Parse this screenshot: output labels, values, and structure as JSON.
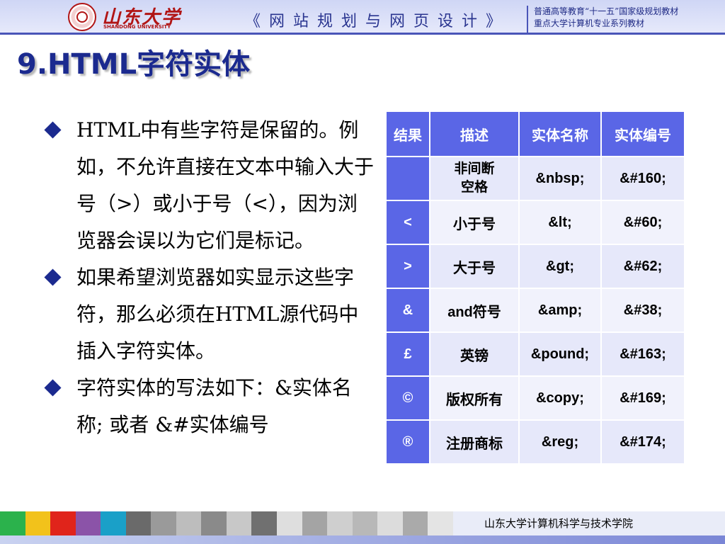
{
  "header": {
    "logo_cn": "山东大学",
    "logo_en": "SHANDONG UNIVERSITY",
    "course_title": "《网站规划与网页设计》",
    "series_line1": "普通高等教育“十一五”国家级规划教材",
    "series_line2": "重点大学计算机专业系列教材"
  },
  "slide": {
    "title": "9.HTML字符实体"
  },
  "bullets": [
    "HTML中有些字符是保留的。例如，不允许直接在文本中输入大于号（>）或小于号（<），因为浏览器会误以为它们是标记。",
    "如果希望浏览器如实显示这些字符，那么必须在HTML源代码中插入字符实体。",
    "字符实体的写法如下：&实体名称; 或者 &#实体编号"
  ],
  "table": {
    "headers": [
      "结果",
      "描述",
      "实体名称",
      "实体编号"
    ],
    "rows": [
      [
        "",
        "非间断空格",
        "&nbsp;",
        "&#160;"
      ],
      [
        "<",
        "小于号",
        "&lt;",
        "&#60;"
      ],
      [
        ">",
        "大于号",
        "&gt;",
        "&#62;"
      ],
      [
        "&",
        "and符号",
        "&amp;",
        "&#38;"
      ],
      [
        "£",
        "英镑",
        "&pound;",
        "&#163;"
      ],
      [
        "©",
        "版权所有",
        "&copy;",
        "&#169;"
      ],
      [
        "®",
        "注册商标",
        "&reg;",
        "&#174;"
      ]
    ]
  },
  "footer": {
    "text": "山东大学计算机科学与技术学院",
    "swatch_colors": [
      "#2bb24c",
      "#f2c21b",
      "#e0241b",
      "#8b53a8",
      "#1aa0c8",
      "#6a6a6a",
      "#9a9a9a",
      "#bdbdbd",
      "#8a8a8a",
      "#c8c8c8",
      "#707070",
      "#dedede",
      "#a4a4a4",
      "#cfcfcf",
      "#b8b8b8",
      "#dcdcdc",
      "#aaaaaa",
      "#e4e4e4"
    ]
  }
}
